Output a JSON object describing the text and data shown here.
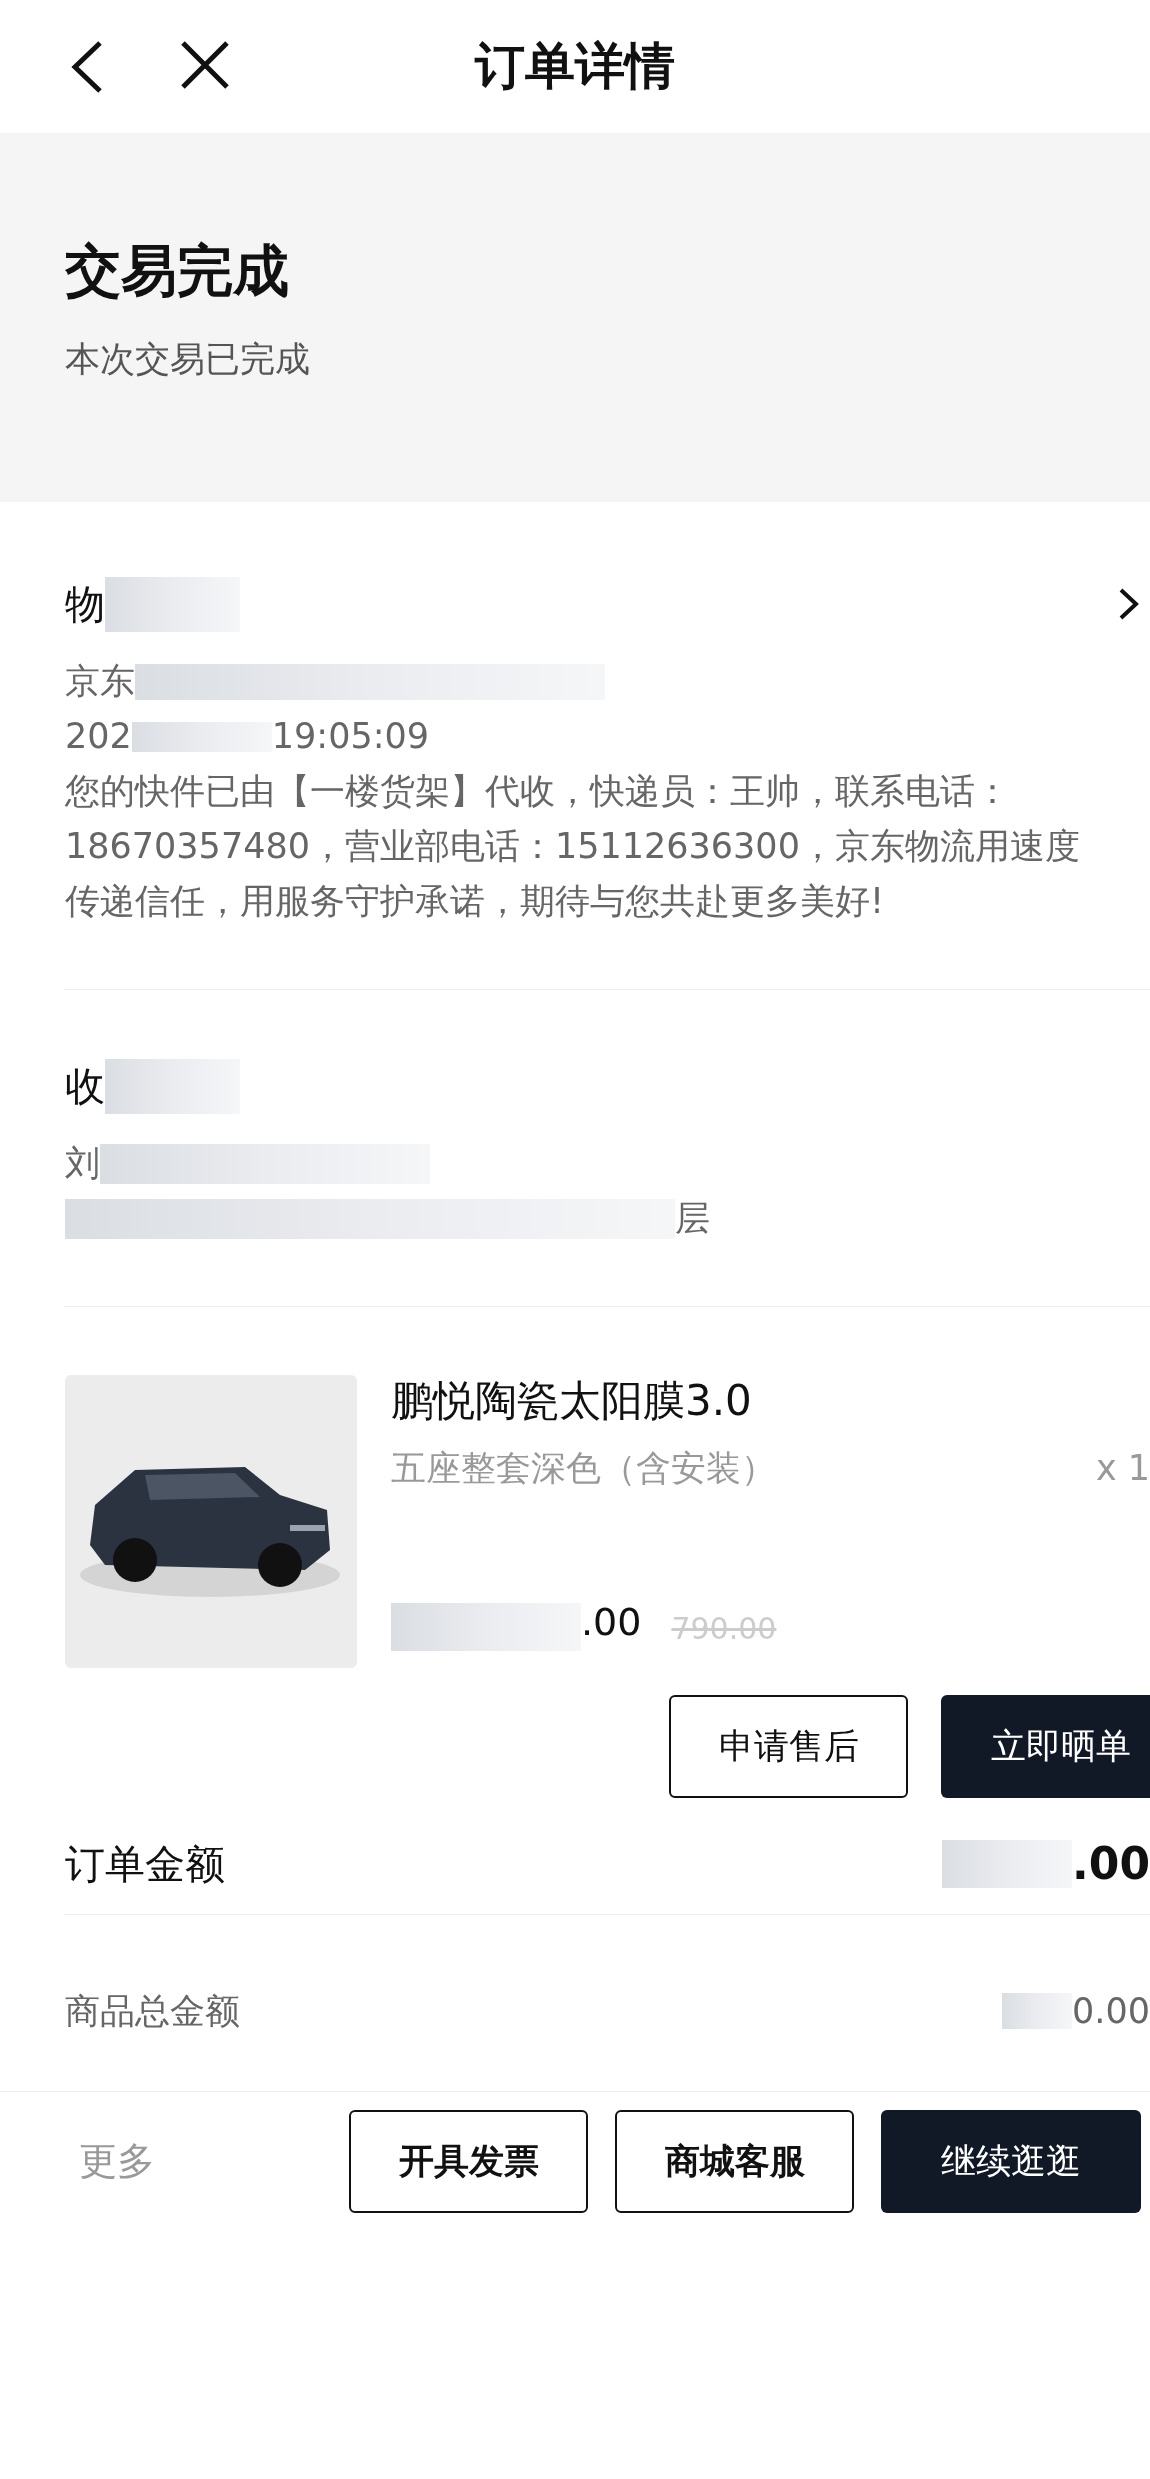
{
  "header": {
    "title": "订单详情"
  },
  "status": {
    "title": "交易完成",
    "subtitle": "本次交易已完成"
  },
  "logistics": {
    "title": "物",
    "company": "京东",
    "time_start": "202",
    "time_end": "19:05:09",
    "message": "您的快件已由【一楼货架】代收，快递员：王帅，联系电话：18670357480，营业部电话：15112636300，京东物流用速度传递信任，用服务守护承诺，期待与您共赴更多美好!"
  },
  "address": {
    "title": "收",
    "name": "刘",
    "detail_end": "层"
  },
  "product": {
    "name": "鹏悦陶瓷太阳膜3.0",
    "spec": "五座整套深色（含安装）",
    "quantity": "x 1",
    "price_end": ".00",
    "original_price": "790.00"
  },
  "actions": [
    "申请售后",
    "立即晒单"
  ],
  "order_amount": {
    "label": "订单金额",
    "value_end": ".00"
  },
  "goods_total": {
    "label": "商品总金额",
    "value_end": "0.00"
  },
  "bottom_bar": {
    "more": "更多",
    "buttons": [
      {
        "label": "开具发票",
        "primary": false
      },
      {
        "label": "商城客服",
        "primary": false
      },
      {
        "label": "继续逛逛",
        "primary": true
      }
    ]
  }
}
